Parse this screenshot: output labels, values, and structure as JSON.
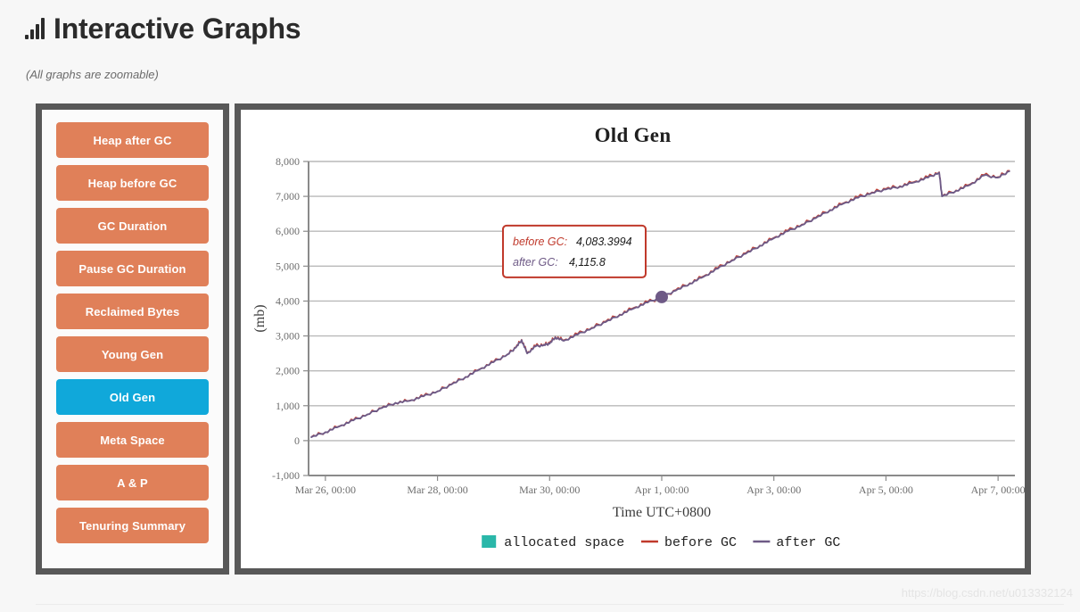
{
  "header": {
    "title": "Interactive Graphs",
    "subtitle": "(All graphs are zoomable)",
    "icon": "bar-chart-icon"
  },
  "sidebar": {
    "items": [
      {
        "label": "Heap after GC",
        "active": false
      },
      {
        "label": "Heap before GC",
        "active": false
      },
      {
        "label": "GC Duration",
        "active": false
      },
      {
        "label": "Pause GC Duration",
        "active": false
      },
      {
        "label": "Reclaimed Bytes",
        "active": false
      },
      {
        "label": "Young Gen",
        "active": false
      },
      {
        "label": "Old Gen",
        "active": true
      },
      {
        "label": "Meta Space",
        "active": false
      },
      {
        "label": "A & P",
        "active": false
      },
      {
        "label": "Tenuring Summary",
        "active": false
      }
    ],
    "colors": {
      "button": "#e08059",
      "button_active": "#10a8da",
      "button_text": "#ffffff"
    }
  },
  "tooltip": {
    "rows": [
      {
        "label": "before GC:",
        "value": "4,083.3994",
        "color": "#c0392b"
      },
      {
        "label": "after GC:",
        "value": "4,115.8",
        "color": "#6e5a86"
      }
    ],
    "border_color": "#c0392b",
    "background": "#ffffff"
  },
  "watermark": "https://blog.csdn.net/u013332124",
  "chart_data": {
    "type": "line",
    "title": "Old Gen",
    "xlabel": "Time UTC+0800",
    "ylabel": "(mb)",
    "ylim": [
      -1000,
      8000
    ],
    "yticks": [
      -1000,
      0,
      1000,
      2000,
      3000,
      4000,
      5000,
      6000,
      7000,
      8000
    ],
    "ytick_labels": [
      "-1,000",
      "0",
      "1,000",
      "2,000",
      "3,000",
      "4,000",
      "5,000",
      "6,000",
      "7,000",
      "8,000"
    ],
    "xtick_labels": [
      "Mar 26, 00:00",
      "Mar 28, 00:00",
      "Mar 30, 00:00",
      "Apr 1, 00:00",
      "Apr 3, 00:00",
      "Apr 5, 00:00",
      "Apr 7, 00:00"
    ],
    "xlim_days": [
      25.7,
      38.3
    ],
    "xticks_days": [
      26,
      28,
      30,
      32,
      34,
      36,
      38
    ],
    "grid": true,
    "legend_position": "bottom",
    "legend": [
      {
        "name": "allocated space",
        "color": "#2ab7a9",
        "marker": "square"
      },
      {
        "name": "before GC",
        "color": "#c0392b",
        "marker": "line"
      },
      {
        "name": "after GC",
        "color": "#6e5a86",
        "marker": "line"
      }
    ],
    "hover_point": {
      "x_days": 32.0,
      "y": 4115.8,
      "color": "#6e5a86"
    },
    "x": [
      25.75,
      26.0,
      26.25,
      26.5,
      26.75,
      27.0,
      27.25,
      27.5,
      27.75,
      28.0,
      28.25,
      28.5,
      28.75,
      29.0,
      29.25,
      29.4,
      29.5,
      29.6,
      29.75,
      29.9,
      30.0,
      30.1,
      30.25,
      30.5,
      30.75,
      31.0,
      31.25,
      31.5,
      31.75,
      32.0,
      32.25,
      32.5,
      32.75,
      33.0,
      33.25,
      33.5,
      33.75,
      34.0,
      34.25,
      34.5,
      34.75,
      35.0,
      35.25,
      35.5,
      35.75,
      36.0,
      36.25,
      36.5,
      36.75,
      36.95,
      37.0,
      37.25,
      37.5,
      37.75,
      38.0,
      38.2
    ],
    "series": [
      {
        "name": "before GC",
        "color": "#c0392b",
        "values": [
          110,
          250,
          420,
          590,
          760,
          940,
          1090,
          1150,
          1280,
          1420,
          1620,
          1830,
          2050,
          2260,
          2480,
          2680,
          2900,
          2520,
          2720,
          2760,
          2800,
          2980,
          2880,
          3060,
          3240,
          3420,
          3620,
          3810,
          3980,
          4083,
          4320,
          4520,
          4720,
          4950,
          5180,
          5380,
          5600,
          5820,
          6020,
          6200,
          6400,
          6620,
          6820,
          6980,
          7120,
          7220,
          7300,
          7420,
          7560,
          7700,
          7010,
          7180,
          7350,
          7620,
          7560,
          7740
        ]
      },
      {
        "name": "after GC",
        "color": "#6e5a86",
        "values": [
          100,
          240,
          410,
          580,
          750,
          930,
          1080,
          1140,
          1270,
          1410,
          1610,
          1820,
          2040,
          2250,
          2470,
          2670,
          2880,
          2500,
          2700,
          2740,
          2780,
          2960,
          2860,
          3040,
          3220,
          3400,
          3600,
          3790,
          3960,
          4116,
          4300,
          4500,
          4700,
          4930,
          5160,
          5360,
          5580,
          5800,
          6000,
          6180,
          6380,
          6600,
          6800,
          6960,
          7100,
          7200,
          7280,
          7400,
          7540,
          7680,
          7000,
          7160,
          7330,
          7600,
          7540,
          7720
        ]
      }
    ]
  }
}
